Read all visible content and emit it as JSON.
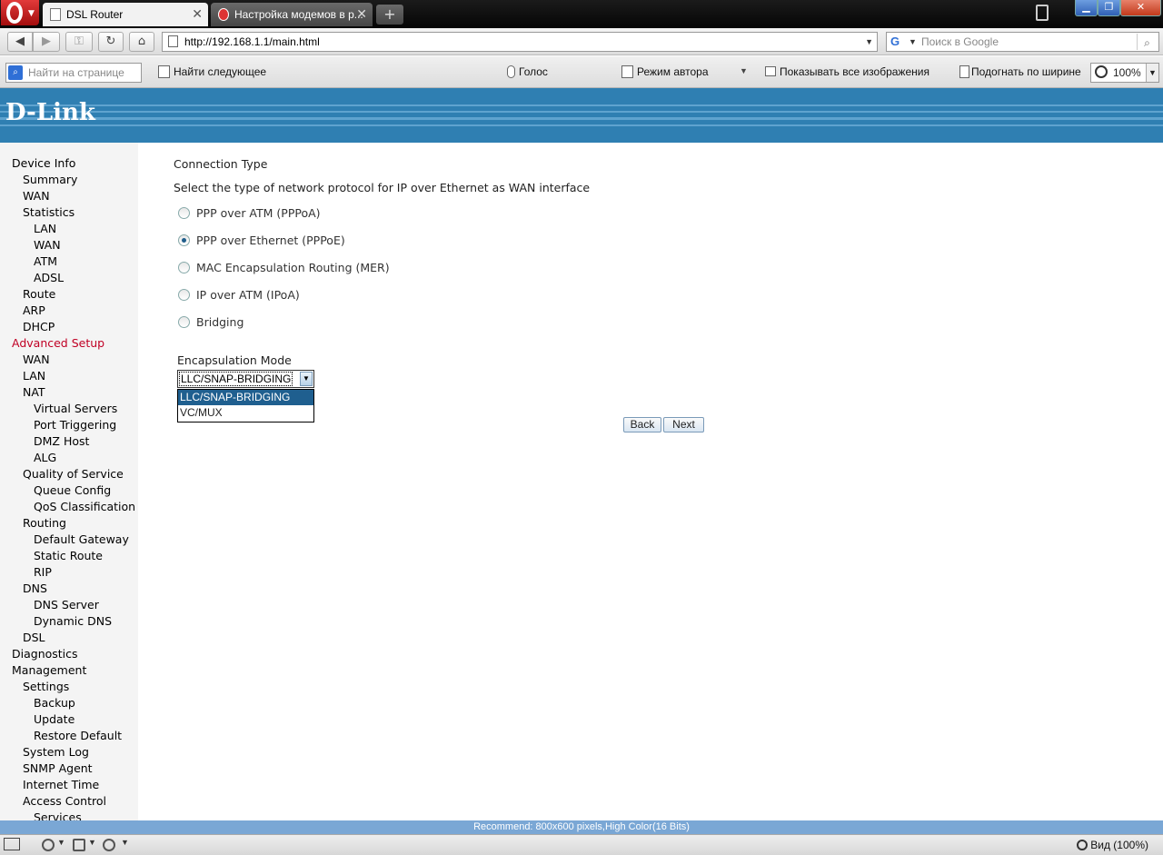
{
  "browser": {
    "tabs": [
      {
        "label": "DSL Router",
        "active": true
      },
      {
        "label": "Настройка модемов в р...",
        "active": false
      }
    ],
    "new_tab_glyph": "+",
    "close_glyph": "✕",
    "address": "http://192.168.1.1/main.html",
    "search_placeholder": "Поиск в Google"
  },
  "findbar": {
    "find_placeholder": "Найти на странице",
    "find_next": "Найти следующее",
    "voice": "Голос",
    "author_mode": "Режим автора",
    "show_images": "Показывать все изображения",
    "fit_width": "Подогнать по ширине",
    "zoom": "100%"
  },
  "brand": {
    "logo": "D-Link",
    "color": "#2f7fb2"
  },
  "sidebar": {
    "items": [
      {
        "label": "Device Info",
        "level": 0
      },
      {
        "label": "Summary",
        "level": 1
      },
      {
        "label": "WAN",
        "level": 1
      },
      {
        "label": "Statistics",
        "level": 1
      },
      {
        "label": "LAN",
        "level": 2
      },
      {
        "label": "WAN",
        "level": 2
      },
      {
        "label": "ATM",
        "level": 2
      },
      {
        "label": "ADSL",
        "level": 2
      },
      {
        "label": "Route",
        "level": 1
      },
      {
        "label": "ARP",
        "level": 1
      },
      {
        "label": "DHCP",
        "level": 1
      },
      {
        "label": "Advanced Setup",
        "level": 0,
        "active": true
      },
      {
        "label": "WAN",
        "level": 1
      },
      {
        "label": "LAN",
        "level": 1
      },
      {
        "label": "NAT",
        "level": 1
      },
      {
        "label": "Virtual Servers",
        "level": 2
      },
      {
        "label": "Port Triggering",
        "level": 2
      },
      {
        "label": "DMZ Host",
        "level": 2
      },
      {
        "label": "ALG",
        "level": 2
      },
      {
        "label": "Quality of Service",
        "level": 1
      },
      {
        "label": "Queue Config",
        "level": 2
      },
      {
        "label": "QoS Classification",
        "level": 2
      },
      {
        "label": "Routing",
        "level": 1
      },
      {
        "label": "Default Gateway",
        "level": 2
      },
      {
        "label": "Static Route",
        "level": 2
      },
      {
        "label": "RIP",
        "level": 2
      },
      {
        "label": "DNS",
        "level": 1
      },
      {
        "label": "DNS Server",
        "level": 2
      },
      {
        "label": "Dynamic DNS",
        "level": 2
      },
      {
        "label": "DSL",
        "level": 1
      },
      {
        "label": "Diagnostics",
        "level": 0
      },
      {
        "label": "Management",
        "level": 0
      },
      {
        "label": "Settings",
        "level": 1
      },
      {
        "label": "Backup",
        "level": 2
      },
      {
        "label": "Update",
        "level": 2
      },
      {
        "label": "Restore Default",
        "level": 2
      },
      {
        "label": "System Log",
        "level": 1
      },
      {
        "label": "SNMP Agent",
        "level": 1
      },
      {
        "label": "Internet Time",
        "level": 1
      },
      {
        "label": "Access Control",
        "level": 1
      },
      {
        "label": "Services",
        "level": 2
      }
    ]
  },
  "content": {
    "title": "Connection Type",
    "description": "Select the type of network protocol for IP over Ethernet as WAN interface",
    "options": [
      {
        "label": "PPP over ATM (PPPoA)",
        "checked": false
      },
      {
        "label": "PPP over Ethernet (PPPoE)",
        "checked": true
      },
      {
        "label": "MAC Encapsulation Routing (MER)",
        "checked": false
      },
      {
        "label": "IP over ATM (IPoA)",
        "checked": false
      },
      {
        "label": "Bridging",
        "checked": false
      }
    ],
    "encapsulation_label": "Encapsulation Mode",
    "encapsulation_value": "LLC/SNAP-BRIDGING",
    "encapsulation_options": [
      "LLC/SNAP-BRIDGING",
      "VC/MUX"
    ],
    "back_label": "Back",
    "next_label": "Next"
  },
  "recommend": "Recommend: 800x600 pixels,High Color(16 Bits)",
  "statusbar": {
    "view": "Вид (100%)"
  }
}
